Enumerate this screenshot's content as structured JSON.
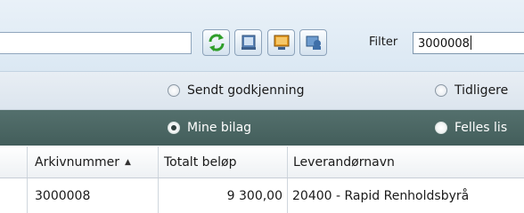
{
  "toolbar": {
    "filter_label": "Filter",
    "filter_value": "3000008",
    "search_value": ""
  },
  "radios_light": [
    {
      "label": "Sendt godkjenning",
      "checked": false
    },
    {
      "label": "Tidligere",
      "checked": false
    }
  ],
  "radios_dark": [
    {
      "label": "Mine bilag",
      "checked": true
    },
    {
      "label": "Felles lis",
      "checked": false
    }
  ],
  "grid": {
    "columns": [
      "Arkivnummer",
      "Totalt beløp",
      "Leverandørnavn"
    ],
    "rows": [
      {
        "arkivnummer": "3000008",
        "totalt_belop": "9 300,00",
        "leverandornavn": "20400 - Rapid Renholdsbyrå"
      }
    ]
  },
  "colors": {
    "toolbar_bg": "#dbe8f3",
    "dark_row_bg": "#4b6764",
    "refresh_green": "#3aa52f"
  }
}
